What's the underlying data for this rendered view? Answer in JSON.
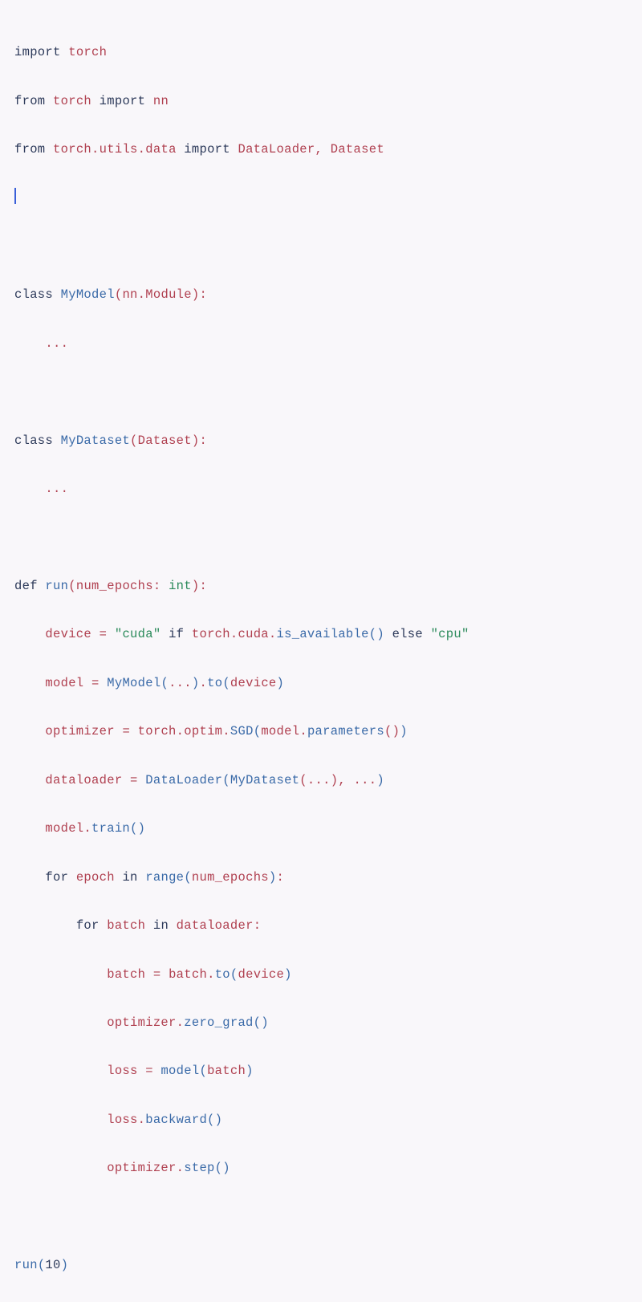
{
  "code": {
    "tokens": {
      "import": "import",
      "from": "from",
      "class": "class",
      "def": "def",
      "if_": "if",
      "else_": "else",
      "for_": "for",
      "in_": "in",
      "torch": "torch",
      "nn": "nn",
      "utils": "utils",
      "data": "data",
      "DataLoader": "DataLoader",
      "Dataset": "Dataset",
      "MyModel": "MyModel",
      "Module": "Module",
      "MyDataset": "MyDataset",
      "run": "run",
      "num_epochs": "num_epochs",
      "int_t": "int",
      "device": "device",
      "cuda_str": "\"cuda\"",
      "cpu_str": "\"cpu\"",
      "cuda": "cuda",
      "is_available": "is_available",
      "model": "model",
      "to_": "to",
      "optimizer": "optimizer",
      "optim": "optim",
      "SGD": "SGD",
      "parameters": "parameters",
      "dataloader": "dataloader",
      "train": "train",
      "epoch": "epoch",
      "range": "range",
      "batch": "batch",
      "zero_grad": "zero_grad",
      "loss": "loss",
      "backward": "backward",
      "step": "step",
      "ellipsis": "...",
      "ten": "10",
      "comma": ",",
      "colon": ":",
      "eq": "=",
      "lparen": "(",
      "rparen": ")",
      "dot": "."
    }
  }
}
